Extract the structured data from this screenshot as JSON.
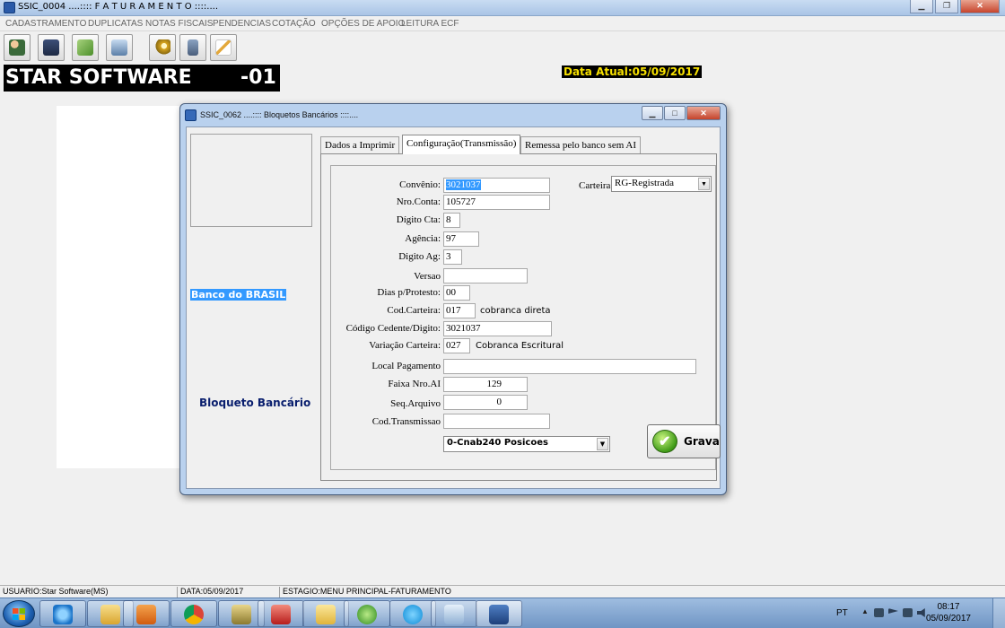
{
  "window": {
    "title": "SSIC_0004 ....:::: F A T U R A M E N T O ::::...."
  },
  "menu": [
    "CADASTRAMENTO",
    "DUPLICATAS",
    "NOTAS FISCAIS",
    "PENDENCIAS",
    "COTAÇÃO",
    "OPÇÕES DE APOIO",
    "LEITURA ECF"
  ],
  "toolbar_icons": [
    "users-icon",
    "trash-icon",
    "money-icon",
    "computer-icon",
    "search-keys-icon",
    "calculator-icon",
    "edit-icon"
  ],
  "brand": {
    "name": "STAR SOFTWARE",
    "code": "-01"
  },
  "date_now": "Data Atual:05/09/2017",
  "dialog": {
    "title": "SSIC_0062 ....:::: Bloquetos Bancários ::::....",
    "bank_label": "Banco do BRASIL",
    "doc_label": "Bloqueto Bancário",
    "tabs": [
      "Dados a Imprimir",
      "Configuração(Transmissão)",
      "Remessa pelo banco sem AI"
    ],
    "active_tab": 1,
    "fields": {
      "convenio": {
        "label": "Convênio:",
        "value": "3021037"
      },
      "conta": {
        "label": "Nro.Conta:",
        "value": "105727"
      },
      "digito_cta": {
        "label": "Dígito Cta:",
        "value": "8"
      },
      "agencia": {
        "label": "Agência:",
        "value": "97"
      },
      "digito_ag": {
        "label": "Digito Ag:",
        "value": "3"
      },
      "versao": {
        "label": "Versao",
        "value": ""
      },
      "dias_protesto": {
        "label": "Dias p/Protesto:",
        "value": "00"
      },
      "cod_carteira": {
        "label": "Cod.Carteira:",
        "value": "017",
        "note": "cobranca direta"
      },
      "cod_cedente": {
        "label": "Código Cedente/Digito:",
        "value": "3021037"
      },
      "variacao_carteira": {
        "label": "Variação Carteira:",
        "value": "027",
        "note": "Cobranca Escritural"
      },
      "local_pagamento": {
        "label": "Local Pagamento",
        "value": ""
      },
      "faixa_nro_ai": {
        "label": "Faixa Nro.AI",
        "value": "129"
      },
      "seq_arquivo": {
        "label": "Seq.Arquivo",
        "value": "0"
      },
      "cod_transmissao": {
        "label": "Cod.Transmissao",
        "value": ""
      },
      "carteira": {
        "label": "Carteira",
        "value": "RG-Registrada"
      },
      "layout": {
        "value": "0-Cnab240 Posicoes"
      }
    },
    "save_label": "Grava"
  },
  "status": {
    "usuario": "USUARIO:Star Software(MS)",
    "data": "DATA:05/09/2017",
    "estagio": "ESTAGIO:MENU PRINCIPAL-FATURAMENTO"
  },
  "taskbar": {
    "apps": [
      "ie-icon",
      "explorer-icon",
      "media-player-icon",
      "chrome-icon",
      "7zip-icon",
      "acrobat-icon",
      "folder-icon",
      "utorrent-icon",
      "skype-icon",
      "notes-icon",
      "ssic-app-icon"
    ],
    "lang": "PT",
    "time": "08:17",
    "date": "05/09/2017"
  },
  "colors": {
    "accent": "#3399ff",
    "brand_bg": "#000000",
    "date_fg": "#f6e000",
    "bloqueto": "#0a1f6e"
  }
}
